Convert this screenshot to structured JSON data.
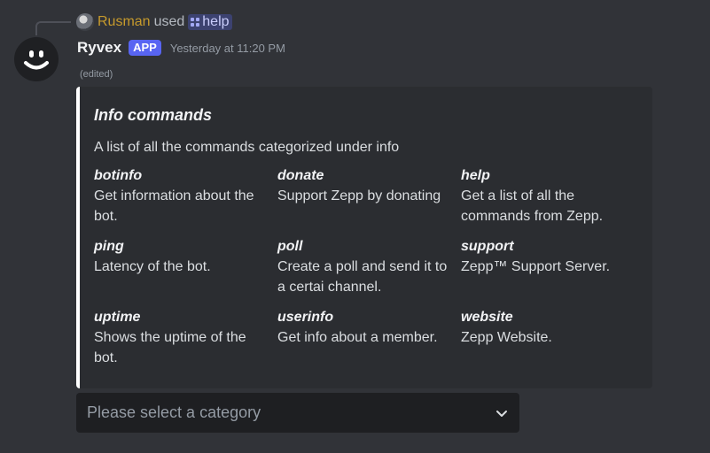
{
  "reply": {
    "user": "Rusman",
    "used_text": "used",
    "command": "help"
  },
  "message": {
    "bot_name": "Ryvex",
    "badge": "APP",
    "timestamp": "Yesterday at 11:20 PM",
    "edited": "(edited)"
  },
  "embed": {
    "accent_color": "#ffffff",
    "title": "Info commands",
    "description": "A list of all the commands categorized under info",
    "fields": [
      {
        "name": "botinfo",
        "value": "Get information about the bot."
      },
      {
        "name": "donate",
        "value": "Support Zepp by donating"
      },
      {
        "name": "help",
        "value": "Get a list of all the commands from Zepp."
      },
      {
        "name": "ping",
        "value": "Latency of the bot."
      },
      {
        "name": "poll",
        "value": "Create a poll and send it to a certai channel."
      },
      {
        "name": "support",
        "value": "Zepp™ Support Server."
      },
      {
        "name": "uptime",
        "value": "Shows the uptime of the bot."
      },
      {
        "name": "userinfo",
        "value": "Get info about a member."
      },
      {
        "name": "website",
        "value": "Zepp Website."
      }
    ]
  },
  "select_menu": {
    "placeholder": "Please select a category",
    "icon": "chevron-down-icon"
  }
}
